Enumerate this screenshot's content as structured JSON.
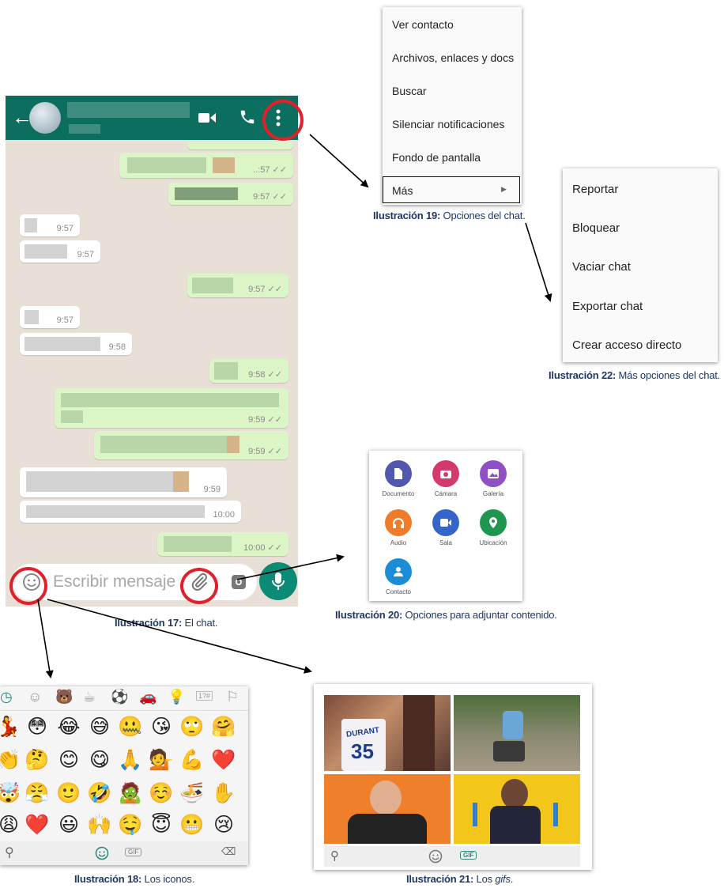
{
  "chat": {
    "times": [
      "..:57",
      "9:57",
      "9:57",
      "9:57",
      "9:57",
      "9:57",
      "9:58",
      "9:58",
      "9:59",
      "9:59",
      "9:59",
      "10:00",
      "10:00"
    ],
    "input_placeholder": "Escribir mensaje",
    "caption_bold": "Ilustración 17:",
    "caption_text": " El chat."
  },
  "chat_options": {
    "items": [
      "Ver contacto",
      "Archivos, enlaces y docs",
      "Buscar",
      "Silenciar notificaciones",
      "Fondo de pantalla",
      "Más"
    ],
    "caption_bold": "Ilustración 19:",
    "caption_text": " Opciones del chat."
  },
  "more_options": {
    "items": [
      "Reportar",
      "Bloquear",
      "Vaciar chat",
      "Exportar chat",
      "Crear acceso directo"
    ],
    "caption_bold": "Ilustración 22:",
    "caption_text": " Más opciones del chat."
  },
  "attach": {
    "items": [
      {
        "label": "Documento",
        "color": "#5157ae",
        "icon": "document-icon"
      },
      {
        "label": "Cámara",
        "color": "#d3396d",
        "icon": "camera-icon"
      },
      {
        "label": "Galería",
        "color": "#8e50c2",
        "icon": "gallery-icon"
      },
      {
        "label": "Audio",
        "color": "#ee7c2a",
        "icon": "headphones-icon"
      },
      {
        "label": "Sala",
        "color": "#3466c9",
        "icon": "video-room-icon"
      },
      {
        "label": "Ubicación",
        "color": "#1e9650",
        "icon": "location-icon"
      },
      {
        "label": "Contacto",
        "color": "#1b8cd6",
        "icon": "contact-icon"
      }
    ],
    "caption_bold": "Ilustración 20:",
    "caption_text": " Opciones para adjuntar contenido."
  },
  "emoji_panel": {
    "tabs": [
      "recent-icon",
      "smiley-icon",
      "animal-icon",
      "food-icon",
      "sport-icon",
      "car-icon",
      "bulb-icon",
      "symbols-icon",
      "flag-icon"
    ],
    "rows": [
      [
        "💃",
        "😳",
        "😂",
        "😅",
        "🤐",
        "😘",
        "🙄",
        "🤗"
      ],
      [
        "👏",
        "🤔",
        "😊",
        "😋",
        "🙏",
        "💁",
        "💪",
        "❤️"
      ],
      [
        "🤯",
        "😤",
        "🙂",
        "🤣",
        "🧟",
        "☺️",
        "🍜",
        "✋"
      ],
      [
        "😩",
        "❤️",
        "😃",
        "🙌",
        "🤤",
        "😇",
        "😬",
        "😢"
      ]
    ],
    "gif_label": "GIF",
    "caption_bold": "Ilustración 18:",
    "caption_text": " Los iconos."
  },
  "gif_panel": {
    "gif_label": "GIF",
    "jersey_text": "DURANT",
    "jersey_number": "35",
    "caption_bold": "Ilustración 21:",
    "caption_text": " Los ",
    "caption_italic": "gifs",
    "caption_end": "."
  },
  "colors": {
    "whatsapp_green": "#0b6e5f",
    "annotation_red": "#e0202a",
    "caption_blue": "#1f3864"
  }
}
